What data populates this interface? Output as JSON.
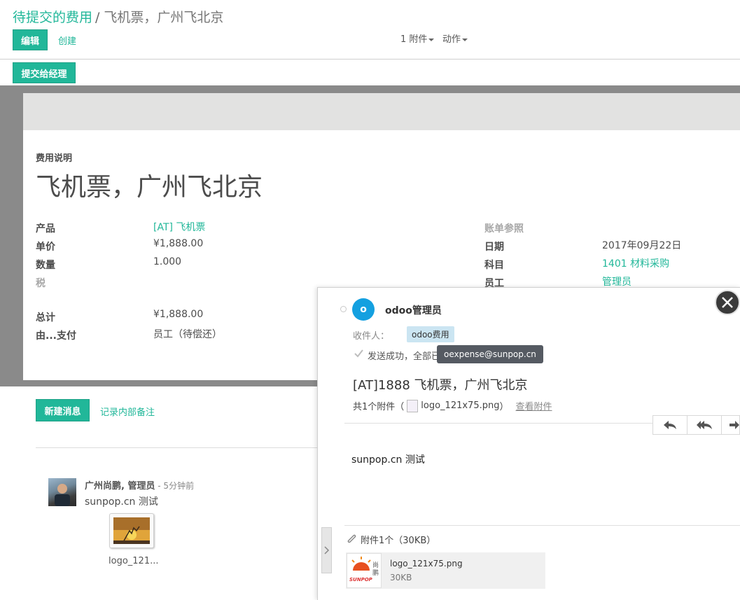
{
  "header": {
    "breadcrumb_parent": "待提交的费用",
    "breadcrumb_sep": "/",
    "breadcrumb_current": "飞机票，广州飞北京",
    "edit_label": "编辑",
    "create_label": "创建",
    "attachments_label": "1 附件",
    "action_label": "动作",
    "submit_label": "提交给经理"
  },
  "form": {
    "desc_label": "费用说明",
    "title": "飞机票，广州飞北京",
    "left_fields": [
      {
        "label": "产品",
        "value": "[AT] 飞机票"
      },
      {
        "label": "单价",
        "value": "¥1,888.00"
      },
      {
        "label": "数量",
        "value": "1.000"
      },
      {
        "label": "税",
        "value": ""
      },
      {
        "label": "总计",
        "value": "¥1,888.00"
      },
      {
        "label": "由...支付",
        "value": "员工（待偿还）"
      }
    ],
    "right_fields": [
      {
        "label": "账单参照",
        "value": ""
      },
      {
        "label": "日期",
        "value": "2017年09月22日"
      },
      {
        "label": "科目",
        "value": "1401 材料采购"
      },
      {
        "label": "员工",
        "value": "管理员"
      }
    ]
  },
  "chatter": {
    "new_message_label": "新建消息",
    "log_note_label": "记录内部备注",
    "message": {
      "author": "广州尚鹏, 管理员",
      "time": " - 5分钟前",
      "body": "sunpop.cn 测试",
      "attachment_name": "logo_121..."
    }
  },
  "popup": {
    "avatar_letter": "o",
    "author": "odoo管理员",
    "recipients_label": "收件人：",
    "recipient_tag": "odoo费用",
    "status_text": "发送成功，全部已",
    "tooltip": "oexpense@sunpop.cn",
    "subject": "[AT]1888 飞机票，广州飞北京",
    "attach_summary_prefix": "共1个附件（",
    "attach_summary_file": "logo_121x75.png",
    "attach_summary_suffix": "）",
    "view_attachments": "查看附件",
    "body": "sunpop.cn 测试",
    "attachments_header": "附件1个（30KB）",
    "file_name": "logo_121x75.png",
    "file_size": "30KB",
    "logo_text": "SUNPOP",
    "logo_side": "尚鹏"
  },
  "colors": {
    "accent": "#21b799",
    "avatar": "#14a0e0",
    "tag_bg": "#cbe5f2"
  }
}
